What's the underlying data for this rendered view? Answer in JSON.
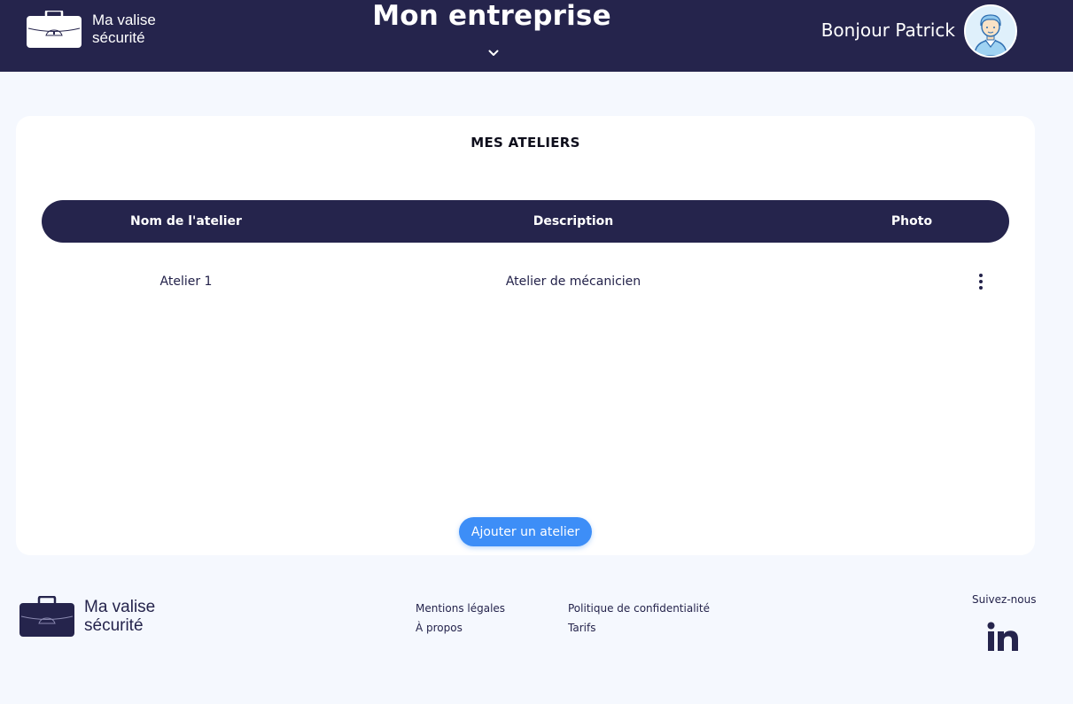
{
  "app": {
    "logo_line1": "Ma valise",
    "logo_line2": "sécurité"
  },
  "header": {
    "company_title": "Mon entreprise",
    "greeting": "Bonjour Patrick",
    "avatar_icon": "user-avatar-icon",
    "chevron_icon": "chevron-down-icon"
  },
  "card": {
    "title": "MES ATELIERS",
    "columns": [
      "Nom de l'atelier",
      "Description",
      "Photo"
    ],
    "rows": [
      {
        "name": "Atelier 1",
        "description": "Atelier de mécanicien",
        "actions_icon": "more-vertical-icon"
      }
    ],
    "add_button": "Ajouter un atelier"
  },
  "footer": {
    "links": [
      "Mentions légales",
      "À propos",
      "Politique de confidentialité",
      "Tarifs"
    ],
    "follow_label": "Suivez-nous",
    "social_icon": "linkedin-icon"
  },
  "colors": {
    "navy": "#25244c",
    "accent_blue": "#3d8ef7",
    "background": "#f5f8fe",
    "card": "#ffffff"
  }
}
